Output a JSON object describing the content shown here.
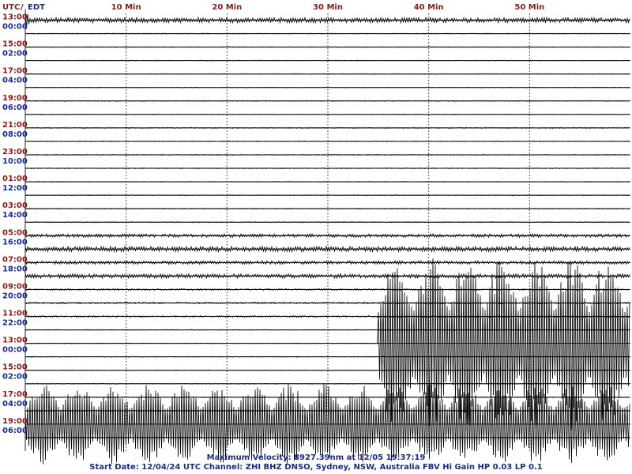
{
  "header": {
    "utc": "UTC",
    "sep": "/",
    "local": "EDT"
  },
  "colors": {
    "utc_label": "#8b1a1a",
    "local_label": "#1a2a8b",
    "trace": "#000000",
    "grid": "#555555"
  },
  "footer": {
    "line1": "Maximum Velocity: 8927.39nm at 12/05 19:37:19",
    "line2": "Start Date: 12/04/24 UTC Channel: ZHI  BHZ  DNSO, Sydney, NSW, Australia  FBV Hi Gain HP 0.03  LP 0.1"
  },
  "chart_data": {
    "type": "line",
    "title": "",
    "xlabel": "",
    "ylabel": "",
    "grid": true,
    "x_axis_unit": "minutes",
    "xlim": [
      0,
      60
    ],
    "x_ticks": [
      {
        "value": 10,
        "label": "10 Min"
      },
      {
        "value": 20,
        "label": "20 Min"
      },
      {
        "value": 30,
        "label": "30 Min"
      },
      {
        "value": 40,
        "label": "40 Min"
      },
      {
        "value": 50,
        "label": "50 Min"
      }
    ],
    "row_labels": [
      {
        "utc": "13:00",
        "local": "00:00"
      },
      {
        "utc": "15:00",
        "local": "02:00"
      },
      {
        "utc": "17:00",
        "local": "04:00"
      },
      {
        "utc": "19:00",
        "local": "06:00"
      },
      {
        "utc": "21:00",
        "local": "08:00"
      },
      {
        "utc": "23:00",
        "local": "10:00"
      },
      {
        "utc": "01:00",
        "local": "12:00"
      },
      {
        "utc": "03:00",
        "local": "14:00"
      },
      {
        "utc": "05:00",
        "local": "16:00"
      },
      {
        "utc": "07:00",
        "local": "18:00"
      },
      {
        "utc": "09:00",
        "local": "20:00"
      },
      {
        "utc": "11:00",
        "local": "22:00"
      },
      {
        "utc": "13:00",
        "local": "00:00"
      },
      {
        "utc": "15:00",
        "local": "02:00"
      },
      {
        "utc": "17:00",
        "local": "04:00"
      },
      {
        "utc": "19:00",
        "local": "06:00"
      }
    ],
    "rows_count": 32,
    "rows_per_label": 2,
    "series": [
      {
        "activity_by_row": [
          0.3,
          0.05,
          0.05,
          0.05,
          0.05,
          0.05,
          0.05,
          0.05,
          0.06,
          0.05,
          0.05,
          0.05,
          0.05,
          0.05,
          0.06,
          0.06,
          0.2,
          0.3,
          0.2,
          0.25,
          0.1,
          0.1,
          0.1,
          0.05,
          0.05,
          0.05,
          0.05,
          0.05,
          0.05,
          0.05,
          0.05,
          0.05
        ],
        "events": [
          {
            "row": 24,
            "start_min": 35,
            "end_min": 60,
            "peak_amplitude_rows": 6.5
          },
          {
            "row": 30,
            "start_min": 0,
            "end_min": 60,
            "peak_amplitude_rows": 3
          }
        ]
      }
    ],
    "max_velocity_nm": 8927.39
  }
}
